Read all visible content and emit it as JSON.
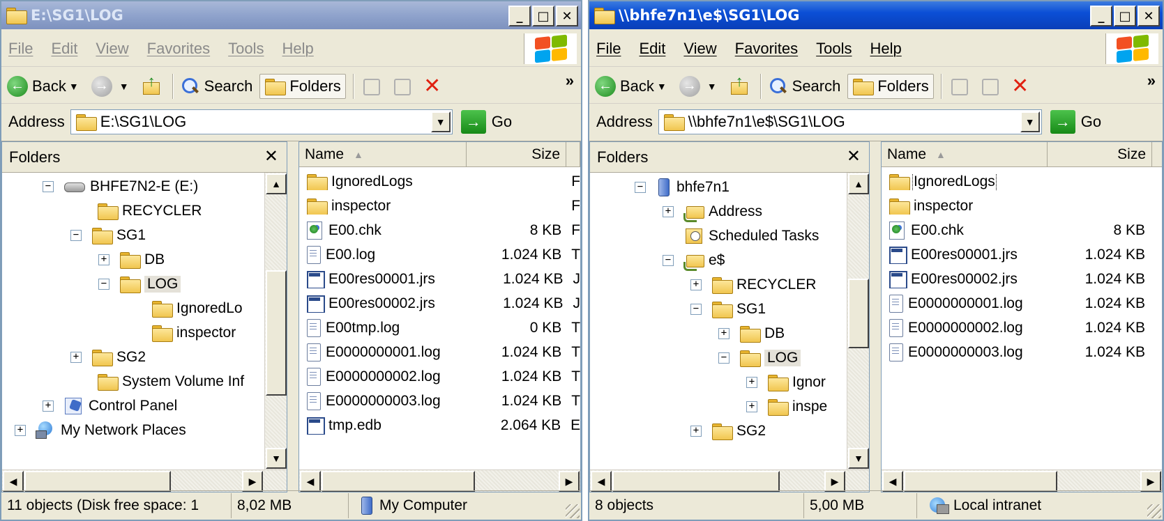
{
  "left": {
    "title": "E:\\SG1\\LOG",
    "menus": [
      "File",
      "Edit",
      "View",
      "Favorites",
      "Tools",
      "Help"
    ],
    "toolbar": {
      "back": "Back",
      "search": "Search",
      "folders": "Folders"
    },
    "address": {
      "label": "Address",
      "value": "E:\\SG1\\LOG",
      "go": "Go"
    },
    "folders_pane": {
      "title": "Folders",
      "tree": [
        {
          "label": "BHFE7N2-E (E:)",
          "expander": "−",
          "icon": "drive-icon"
        },
        {
          "label": "RECYCLER",
          "expander": "",
          "icon": "folder-icon"
        },
        {
          "label": "SG1",
          "expander": "−",
          "icon": "folder-icon"
        },
        {
          "label": "DB",
          "expander": "+",
          "icon": "folder-icon"
        },
        {
          "label": "LOG",
          "expander": "−",
          "icon": "folder-open-icon",
          "selected": true
        },
        {
          "label": "IgnoredLo",
          "expander": "",
          "icon": "folder-icon"
        },
        {
          "label": "inspector",
          "expander": "",
          "icon": "folder-icon"
        },
        {
          "label": "SG2",
          "expander": "+",
          "icon": "folder-icon"
        },
        {
          "label": "System Volume Inf",
          "expander": "",
          "icon": "folder-icon"
        },
        {
          "label": "Control Panel",
          "expander": "+",
          "icon": "control-panel-icon"
        },
        {
          "label": "My Network Places",
          "expander": "+",
          "icon": "network-icon"
        }
      ]
    },
    "columns": {
      "name": "Name",
      "size": "Size"
    },
    "files": [
      {
        "name": "IgnoredLogs",
        "size": "",
        "type": "F",
        "icon": "folder-icon"
      },
      {
        "name": "inspector",
        "size": "",
        "type": "F",
        "icon": "folder-icon"
      },
      {
        "name": "E00.chk",
        "size": "8 KB",
        "type": "F",
        "icon": "chk-file-icon"
      },
      {
        "name": "E00.log",
        "size": "1.024 KB",
        "type": "T",
        "icon": "text-file-icon"
      },
      {
        "name": "E00res00001.jrs",
        "size": "1.024 KB",
        "type": "J",
        "icon": "jrs-file-icon"
      },
      {
        "name": "E00res00002.jrs",
        "size": "1.024 KB",
        "type": "J",
        "icon": "jrs-file-icon"
      },
      {
        "name": "E00tmp.log",
        "size": "0 KB",
        "type": "T",
        "icon": "text-file-icon"
      },
      {
        "name": "E0000000001.log",
        "size": "1.024 KB",
        "type": "T",
        "icon": "text-file-icon"
      },
      {
        "name": "E0000000002.log",
        "size": "1.024 KB",
        "type": "T",
        "icon": "text-file-icon"
      },
      {
        "name": "E0000000003.log",
        "size": "1.024 KB",
        "type": "T",
        "icon": "text-file-icon"
      },
      {
        "name": "tmp.edb",
        "size": "2.064 KB",
        "type": "E",
        "icon": "edb-file-icon"
      }
    ],
    "status": {
      "objects": "11 objects (Disk free space: 1",
      "size": "8,02 MB",
      "zone": "My Computer"
    }
  },
  "right": {
    "title": "\\\\bhfe7n1\\e$\\SG1\\LOG",
    "menus": [
      "File",
      "Edit",
      "View",
      "Favorites",
      "Tools",
      "Help"
    ],
    "toolbar": {
      "back": "Back",
      "search": "Search",
      "folders": "Folders"
    },
    "address": {
      "label": "Address",
      "value": "\\\\bhfe7n1\\e$\\SG1\\LOG",
      "go": "Go"
    },
    "folders_pane": {
      "title": "Folders",
      "tree": [
        {
          "label": "bhfe7n1",
          "expander": "−",
          "icon": "computer-icon"
        },
        {
          "label": "Address",
          "expander": "+",
          "icon": "shared-folder-icon"
        },
        {
          "label": "Scheduled Tasks",
          "expander": "",
          "icon": "scheduled-tasks-icon"
        },
        {
          "label": "e$",
          "expander": "−",
          "icon": "shared-folder-icon"
        },
        {
          "label": "RECYCLER",
          "expander": "+",
          "icon": "folder-icon"
        },
        {
          "label": "SG1",
          "expander": "−",
          "icon": "folder-icon"
        },
        {
          "label": "DB",
          "expander": "+",
          "icon": "folder-icon"
        },
        {
          "label": "LOG",
          "expander": "−",
          "icon": "folder-open-icon",
          "selected": true
        },
        {
          "label": "Ignor",
          "expander": "+",
          "icon": "folder-icon"
        },
        {
          "label": "inspe",
          "expander": "+",
          "icon": "folder-icon"
        },
        {
          "label": "SG2",
          "expander": "+",
          "icon": "folder-icon"
        }
      ]
    },
    "columns": {
      "name": "Name",
      "size": "Size"
    },
    "files": [
      {
        "name": "IgnoredLogs",
        "size": "",
        "icon": "folder-icon",
        "focused": true
      },
      {
        "name": "inspector",
        "size": "",
        "icon": "folder-icon"
      },
      {
        "name": "E00.chk",
        "size": "8 KB",
        "icon": "chk-file-icon"
      },
      {
        "name": "E00res00001.jrs",
        "size": "1.024 KB",
        "icon": "jrs-file-icon"
      },
      {
        "name": "E00res00002.jrs",
        "size": "1.024 KB",
        "icon": "jrs-file-icon"
      },
      {
        "name": "E0000000001.log",
        "size": "1.024 KB",
        "icon": "text-file-icon"
      },
      {
        "name": "E0000000002.log",
        "size": "1.024 KB",
        "icon": "text-file-icon"
      },
      {
        "name": "E0000000003.log",
        "size": "1.024 KB",
        "icon": "text-file-icon"
      }
    ],
    "status": {
      "objects": "8 objects",
      "size": "5,00 MB",
      "zone": "Local intranet"
    }
  }
}
